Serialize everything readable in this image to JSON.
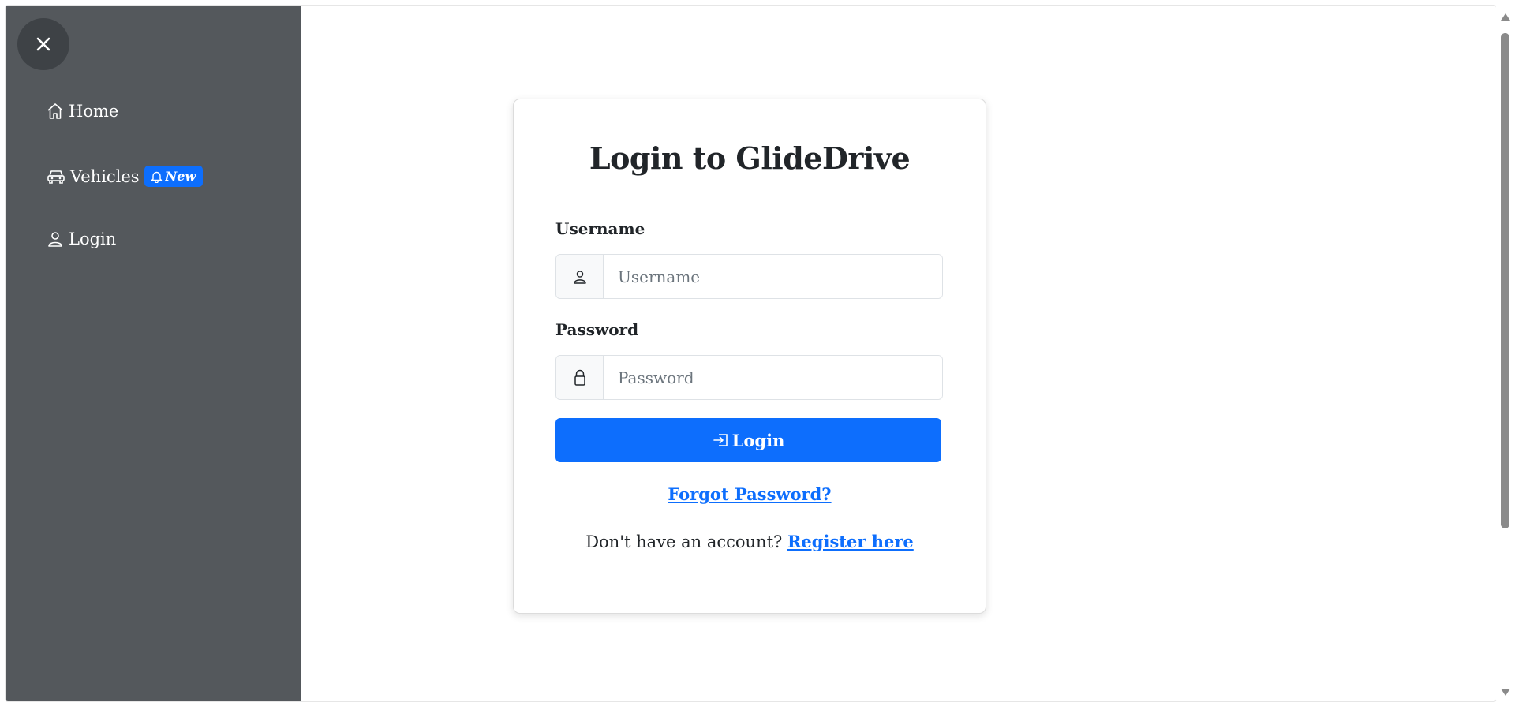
{
  "sidebar": {
    "close_label": "✕",
    "items": [
      {
        "label": "Home",
        "icon": "house-icon"
      },
      {
        "label": "Vehicles",
        "icon": "car-icon",
        "badge": "New",
        "badge_icon": "bell-icon"
      },
      {
        "label": "Login",
        "icon": "person-icon"
      }
    ]
  },
  "login": {
    "title": "Login to GlideDrive",
    "username_label": "Username",
    "username_placeholder": "Username",
    "username_value": "",
    "password_label": "Password",
    "password_placeholder": "Password",
    "password_value": "",
    "submit_label": "Login",
    "forgot_label": "Forgot Password?",
    "register_prompt": "Don't have an account?",
    "register_label": "Register here"
  },
  "colors": {
    "sidebar_bg": "#54585c",
    "accent": "#0d6efd"
  }
}
